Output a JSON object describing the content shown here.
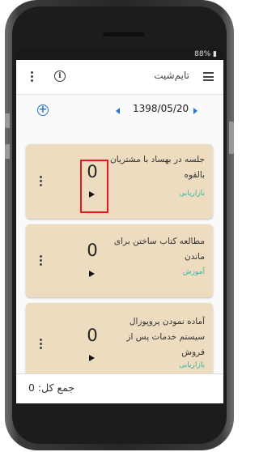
{
  "status_bar": {
    "text": "88% ▮"
  },
  "app_bar": {
    "title": "تایم‌شیت",
    "menu_icon": "hamburger-icon",
    "info_icon": "info-icon",
    "more_icon": "more-vert-icon"
  },
  "date_nav": {
    "date": "1398/05/20",
    "add_icon": "add-circle-icon",
    "prev_icon": "chevron-left-icon",
    "next_icon": "chevron-right-icon"
  },
  "tasks": [
    {
      "title": "جلسه در بهساد با مشتریان بالقوه",
      "tag": "بازاریابی",
      "count": "0"
    },
    {
      "title": "مطالعه کتاب ساختن برای ماندن",
      "tag": "آموزش",
      "count": "0"
    },
    {
      "title": "آماده نمودن پروپوزال سیستم خدمات پس از فروش",
      "tag": "بازاریابی",
      "count": "0"
    }
  ],
  "footer": {
    "total": "جمع کل: 0"
  },
  "colors": {
    "card_bg": "#eddcbf",
    "tag": "#2fb7a2",
    "accent": "#2a78d6",
    "highlight": "#e01b1b"
  }
}
